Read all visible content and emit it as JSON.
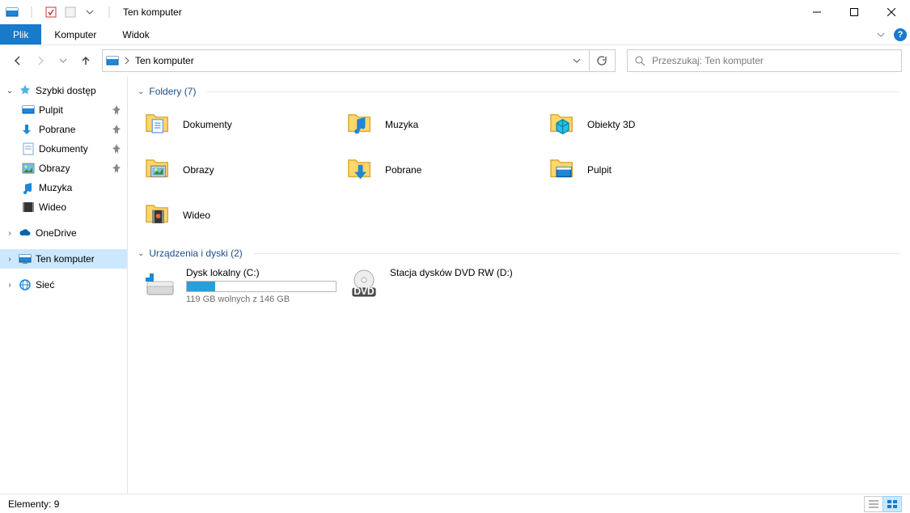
{
  "window": {
    "title": "Ten komputer"
  },
  "ribbon": {
    "file": "Plik",
    "tabs": [
      "Komputer",
      "Widok"
    ]
  },
  "address": {
    "crumb": "Ten komputer"
  },
  "search": {
    "placeholder": "Przeszukaj: Ten komputer"
  },
  "sidebar": {
    "quick_access": "Szybki dostęp",
    "quick_items": [
      {
        "label": "Pulpit",
        "icon": "desktop",
        "pinned": true
      },
      {
        "label": "Pobrane",
        "icon": "download",
        "pinned": true
      },
      {
        "label": "Dokumenty",
        "icon": "documents",
        "pinned": true
      },
      {
        "label": "Obrazy",
        "icon": "pictures",
        "pinned": true
      },
      {
        "label": "Muzyka",
        "icon": "music",
        "pinned": false
      },
      {
        "label": "Wideo",
        "icon": "video",
        "pinned": false
      }
    ],
    "onedrive": "OneDrive",
    "this_pc": "Ten komputer",
    "network": "Sieć"
  },
  "groups": {
    "folders": {
      "title": "Foldery",
      "count": 7
    },
    "devices": {
      "title": "Urządzenia i dyski",
      "count": 2
    }
  },
  "folders": [
    {
      "label": "Dokumenty",
      "icon": "documents"
    },
    {
      "label": "Muzyka",
      "icon": "music"
    },
    {
      "label": "Obiekty 3D",
      "icon": "objects3d"
    },
    {
      "label": "Obrazy",
      "icon": "pictures"
    },
    {
      "label": "Pobrane",
      "icon": "download"
    },
    {
      "label": "Pulpit",
      "icon": "desktop"
    },
    {
      "label": "Wideo",
      "icon": "video"
    }
  ],
  "drives": [
    {
      "label": "Dysk lokalny (C:)",
      "free_text": "119 GB wolnych z 146 GB",
      "used_pct": 19,
      "icon": "hdd"
    },
    {
      "label": "Stacja dysków DVD RW (D:)",
      "free_text": "",
      "used_pct": null,
      "icon": "dvd"
    }
  ],
  "status": {
    "items": "Elementy: 9"
  }
}
